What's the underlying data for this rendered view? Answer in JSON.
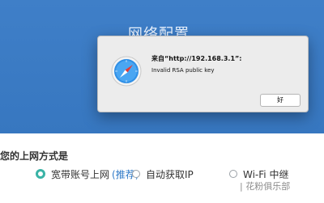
{
  "page": {
    "title": "网络配置",
    "wan_question": "您的上网方式是",
    "options": [
      {
        "label": "宽带账号上网",
        "tag": "(推荐)",
        "checked": true
      },
      {
        "label": "自动获取IP",
        "checked": false
      },
      {
        "label": "Wi-Fi 中继",
        "checked": false
      }
    ],
    "watermark": "| 花粉俱乐部"
  },
  "dialog": {
    "title": "来自“http://192.168.3.1”:",
    "message": "Invalid RSA public key",
    "ok_label": "好",
    "icon": "safari-compass-icon"
  },
  "colors": {
    "header_blue": "#3a7ac4",
    "radio_selected": "#3ab3a6",
    "tag_blue": "#2e79c7"
  }
}
